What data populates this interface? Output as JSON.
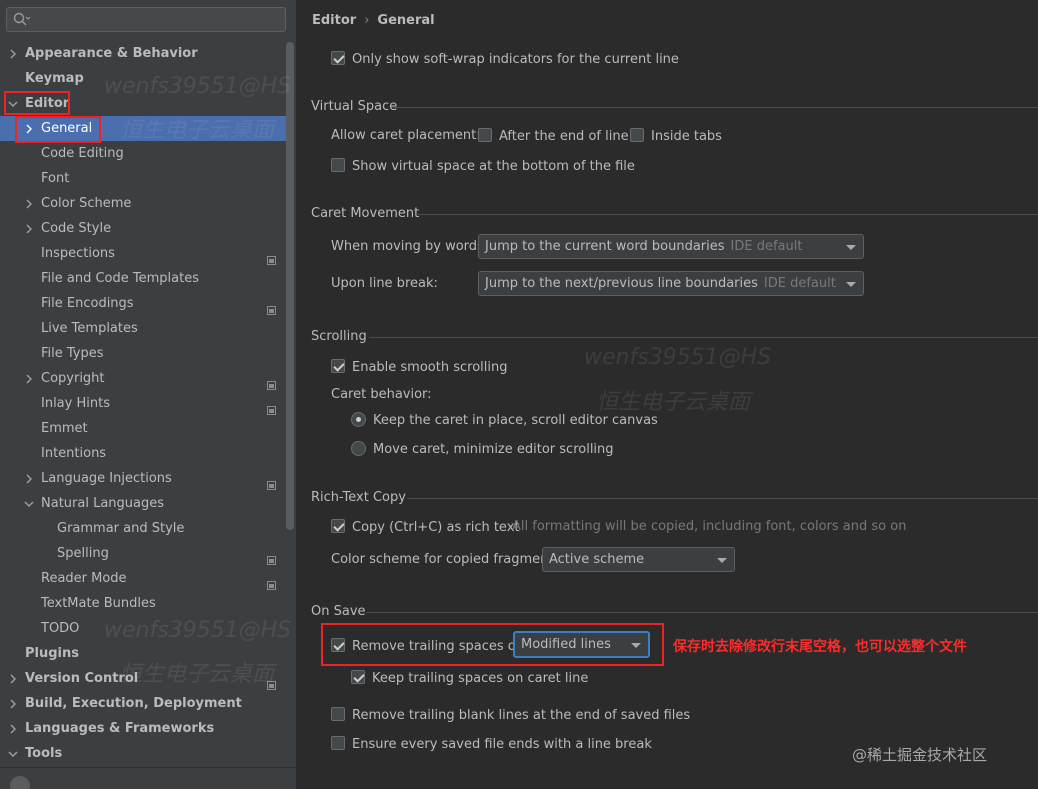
{
  "search": {
    "placeholder": "Q"
  },
  "sidebar": {
    "items": [
      {
        "label": "Appearance & Behavior",
        "chevron": "right"
      },
      {
        "label": "Keymap"
      },
      {
        "label": "Editor",
        "chevron": "down"
      },
      {
        "label": "General",
        "chevron": "right"
      },
      {
        "label": "Code Editing"
      },
      {
        "label": "Font"
      },
      {
        "label": "Color Scheme",
        "chevron": "right"
      },
      {
        "label": "Code Style",
        "chevron": "right"
      },
      {
        "label": "Inspections"
      },
      {
        "label": "File and Code Templates"
      },
      {
        "label": "File Encodings"
      },
      {
        "label": "Live Templates"
      },
      {
        "label": "File Types"
      },
      {
        "label": "Copyright",
        "chevron": "right"
      },
      {
        "label": "Inlay Hints"
      },
      {
        "label": "Emmet"
      },
      {
        "label": "Intentions"
      },
      {
        "label": "Language Injections",
        "chevron": "right"
      },
      {
        "label": "Natural Languages",
        "chevron": "down"
      },
      {
        "label": "Grammar and Style"
      },
      {
        "label": "Spelling"
      },
      {
        "label": "Reader Mode"
      },
      {
        "label": "TextMate Bundles"
      },
      {
        "label": "TODO"
      },
      {
        "label": "Plugins"
      },
      {
        "label": "Version Control",
        "chevron": "right"
      },
      {
        "label": "Build, Execution, Deployment",
        "chevron": "right"
      },
      {
        "label": "Languages & Frameworks",
        "chevron": "right"
      },
      {
        "label": "Tools",
        "chevron": "down"
      }
    ]
  },
  "breadcrumb": {
    "parent": "Editor",
    "separator": "›",
    "current": "General"
  },
  "softwrap": {
    "label": "Only show soft-wrap indicators for the current line",
    "checked": true
  },
  "virtual_space": {
    "title": "Virtual Space",
    "caret_label": "Allow caret placement:",
    "after_end": "After the end of line",
    "inside_tabs": "Inside tabs",
    "show_virtual": "Show virtual space at the bottom of the file"
  },
  "caret_movement": {
    "title": "Caret Movement",
    "words_label": "When moving by words:",
    "words_value": "Jump to the current word boundaries",
    "words_hint": "IDE default",
    "line_label": "Upon line break:",
    "line_value": "Jump to the next/previous line boundaries",
    "line_hint": "IDE default"
  },
  "scrolling": {
    "title": "Scrolling",
    "smooth": "Enable smooth scrolling",
    "caret_behavior": "Caret behavior:",
    "keep_caret": "Keep the caret in place, scroll editor canvas",
    "move_caret": "Move caret, minimize editor scrolling"
  },
  "rich_text": {
    "title": "Rich-Text Copy",
    "copy_label": "Copy (Ctrl+C) as rich text",
    "copy_hint": "All formatting will be copied, including font, colors and so on",
    "scheme_label": "Color scheme for copied fragment:",
    "scheme_value": "Active scheme"
  },
  "on_save": {
    "title": "On Save",
    "remove_trailing": "Remove trailing spaces on:",
    "remove_trailing_value": "Modified lines",
    "keep_trailing": "Keep trailing spaces on caret line",
    "remove_blank": "Remove trailing blank lines at the end of saved files",
    "ensure_break": "Ensure every saved file ends with a line break"
  },
  "annotation": "保存时去除修改行末尾空格，也可以选整个文件",
  "watermarks": {
    "text1": "wenfs39551@HS",
    "text2": "恒生电子云桌面"
  },
  "juejin": "@稀土掘金技术社区",
  "colors": {
    "accent": "#4b6eaf",
    "highlight": "#e22222",
    "focus": "#3d7fc5"
  }
}
